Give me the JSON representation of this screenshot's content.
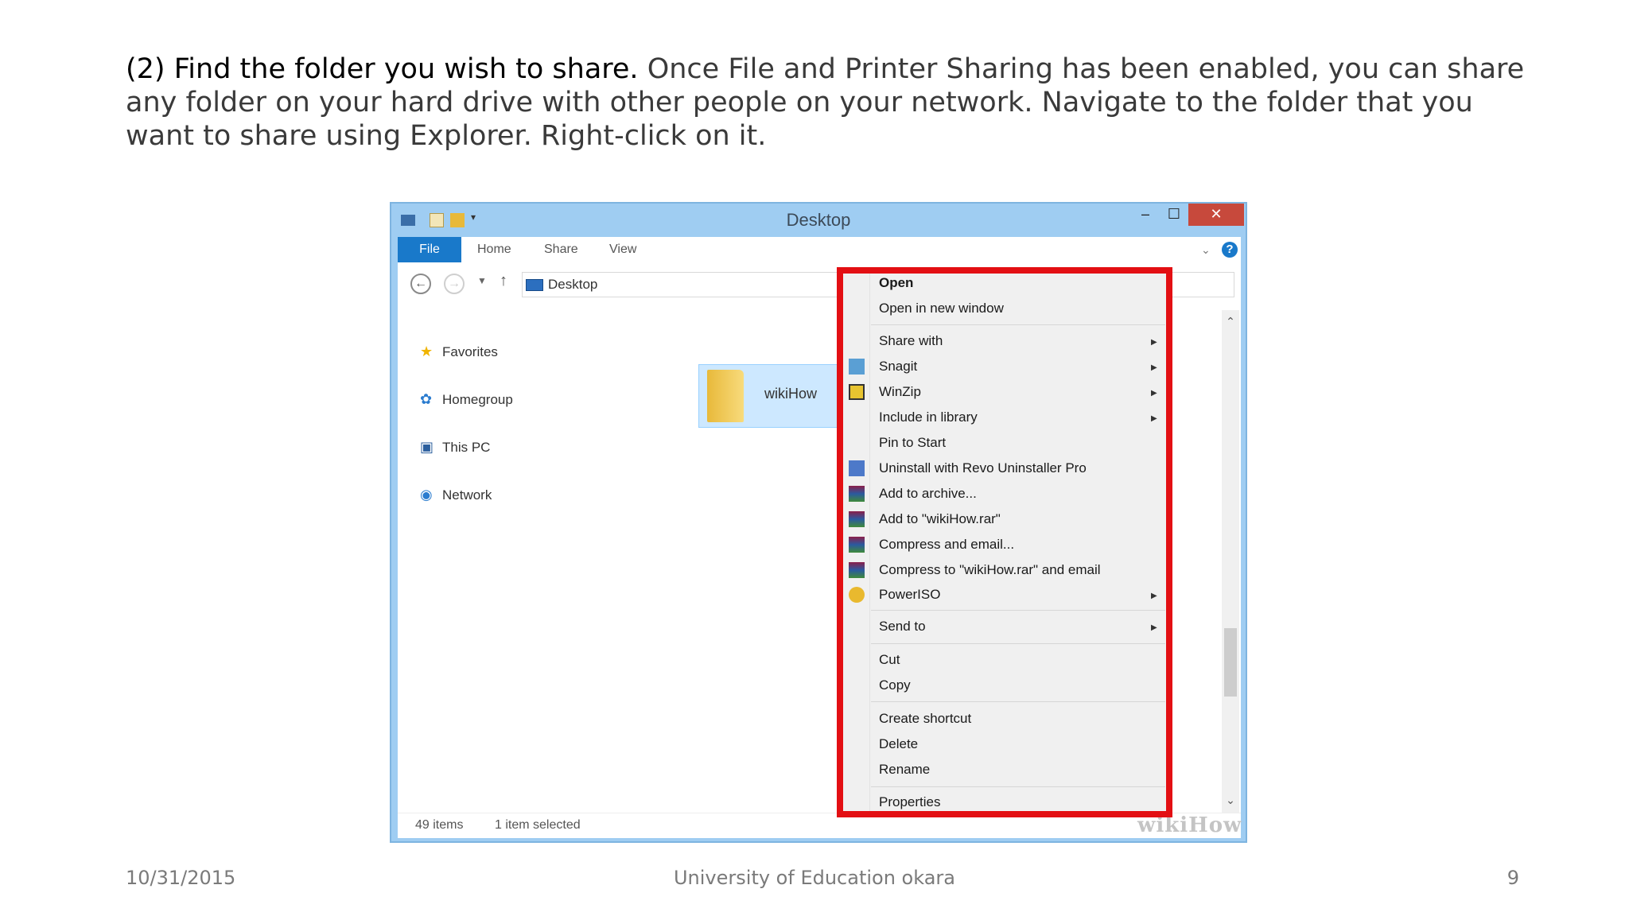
{
  "slide": {
    "heading": "(2) Find the folder you wish to share.",
    "body": " Once File and Printer Sharing has been enabled, you can share any folder on your hard drive with other people on your network. Navigate to the folder that you want to share using Explorer. Right-click on it.",
    "footer_date": "10/31/2015",
    "footer_org": "University of Education okara",
    "footer_page": "9"
  },
  "window": {
    "title": "Desktop",
    "controls": {
      "minimize": "–",
      "maximize": "☐",
      "close": "✕"
    }
  },
  "ribbon": {
    "tabs": {
      "file": "File",
      "home": "Home",
      "share": "Share",
      "view": "View"
    },
    "help": "?"
  },
  "address": {
    "location": "Desktop"
  },
  "nav_pane": {
    "favorites": "Favorites",
    "homegroup": "Homegroup",
    "this_pc": "This PC",
    "network": "Network"
  },
  "folder": {
    "name": "wikiHow"
  },
  "status": {
    "count": "49 items",
    "selected": "1 item selected"
  },
  "watermark": "wikiHow",
  "context_menu": {
    "open": "Open",
    "open_new_window": "Open in new window",
    "share_with": "Share with",
    "snagit": "Snagit",
    "winzip": "WinZip",
    "include_in_library": "Include in library",
    "pin_to_start": "Pin to Start",
    "uninstall_revo": "Uninstall with Revo Uninstaller Pro",
    "add_to_archive": "Add to archive...",
    "add_to_rar": "Add to \"wikiHow.rar\"",
    "compress_email": "Compress and email...",
    "compress_rar_email": "Compress to \"wikiHow.rar\" and email",
    "poweriso": "PowerISO",
    "send_to": "Send to",
    "cut": "Cut",
    "copy": "Copy",
    "create_shortcut": "Create shortcut",
    "delete": "Delete",
    "rename": "Rename",
    "properties": "Properties"
  },
  "colors": {
    "highlight": "#e30f13",
    "accent": "#1979ca",
    "selection": "#cde8ff"
  }
}
